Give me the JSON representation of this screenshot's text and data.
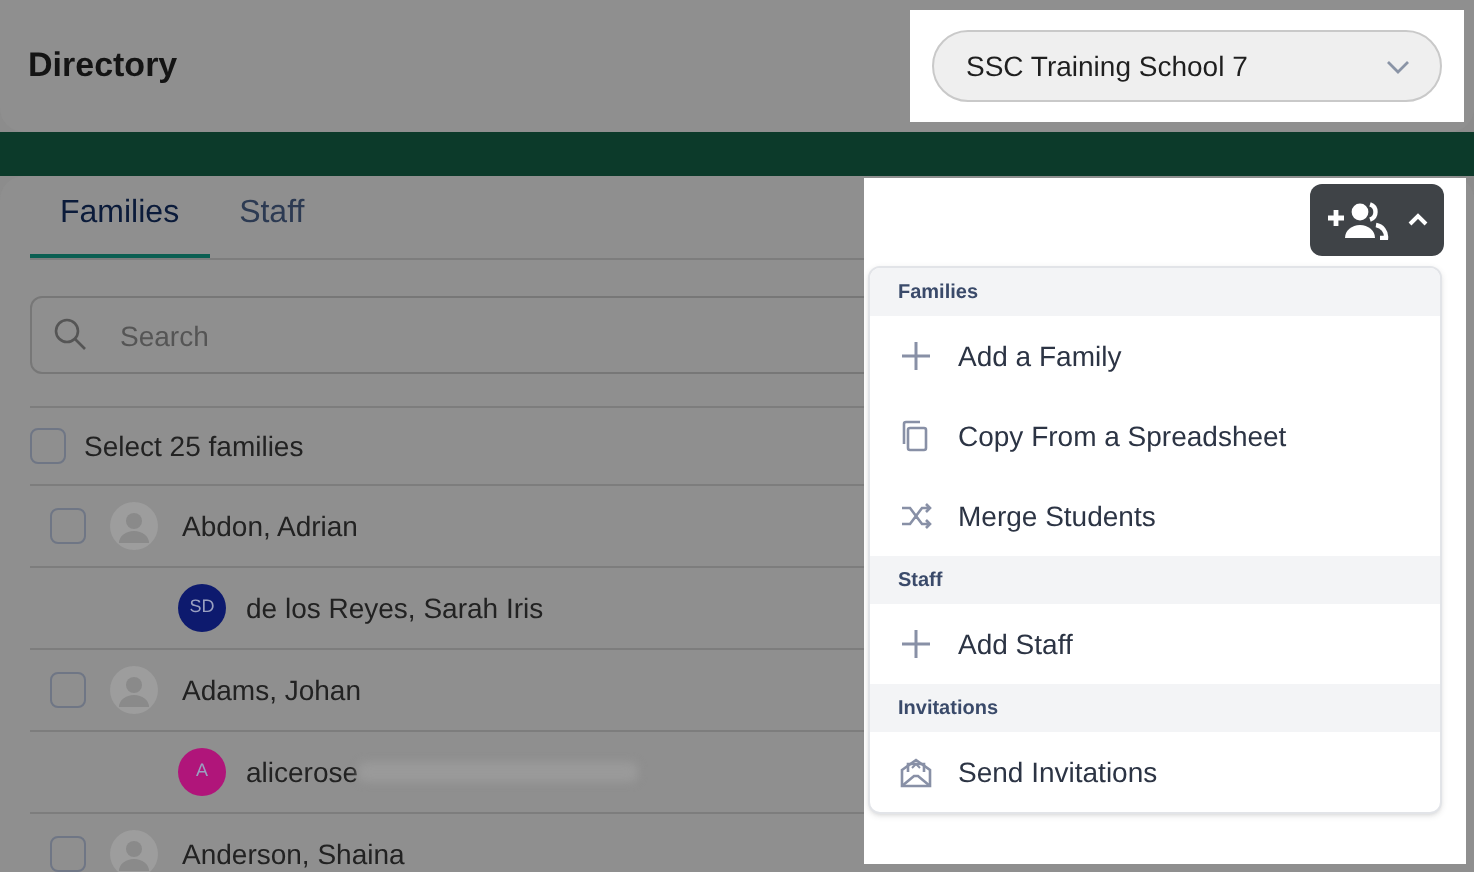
{
  "header": {
    "title": "Directory",
    "school_select": {
      "value": "SSC Training School 7"
    }
  },
  "tabs": [
    {
      "label": "Families",
      "selected": true
    },
    {
      "label": "Staff",
      "selected": false
    }
  ],
  "search": {
    "placeholder": "Search"
  },
  "select_all": {
    "label": "Select 25 families",
    "checked": false
  },
  "rows": [
    {
      "kind": "family",
      "name": "Abdon, Adrian",
      "checked": false
    },
    {
      "kind": "member",
      "name": "de los Reyes, Sarah Iris",
      "initials": "SD",
      "color": "#0d1a6e",
      "redacted": false
    },
    {
      "kind": "family",
      "name": "Adams, Johan",
      "checked": false
    },
    {
      "kind": "member",
      "name": "alicerose",
      "initials": "A",
      "color": "#b0157a",
      "redacted": true
    },
    {
      "kind": "family",
      "name": "Anderson, Shaina",
      "checked": false
    }
  ],
  "add_menu": {
    "expanded": true,
    "sections": [
      {
        "title": "Families",
        "items": [
          {
            "kind": "add",
            "label": "Add a Family"
          },
          {
            "kind": "copy",
            "label": "Copy From a Spreadsheet"
          },
          {
            "kind": "merge",
            "label": "Merge Students"
          }
        ]
      },
      {
        "title": "Staff",
        "items": [
          {
            "kind": "add",
            "label": "Add Staff"
          }
        ]
      },
      {
        "title": "Invitations",
        "items": [
          {
            "kind": "invite",
            "label": "Send Invitations"
          }
        ]
      }
    ]
  }
}
